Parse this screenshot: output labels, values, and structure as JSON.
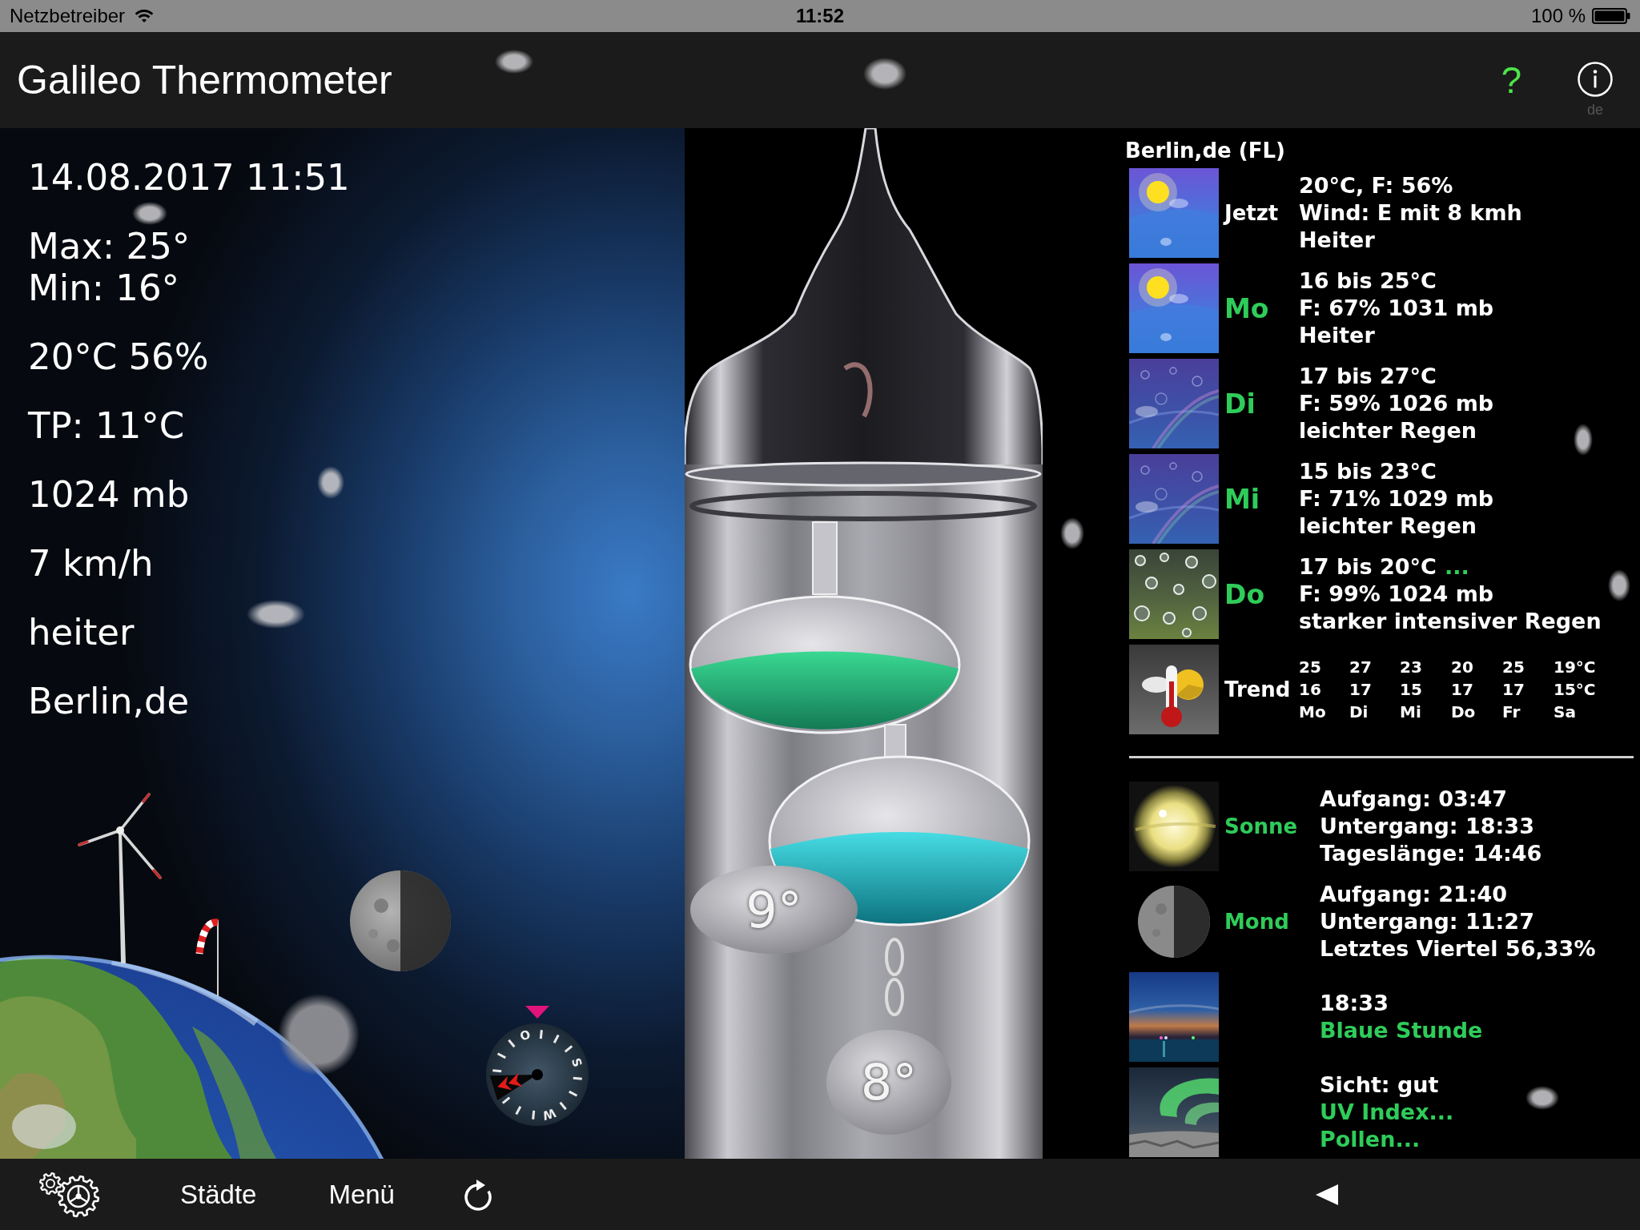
{
  "status_bar": {
    "carrier": "Netzbetreiber",
    "time": "11:52",
    "battery": "100 %"
  },
  "title_bar": {
    "title": "Galileo Thermometer",
    "help": "?",
    "language": "de"
  },
  "readings": [
    [
      "14.08.2017 11:51"
    ],
    [
      "Max: 25°",
      "Min: 16°"
    ],
    [
      "20°C 56%"
    ],
    [
      "TP: 11°C"
    ],
    [
      "1024 mb"
    ],
    [
      "7 km/h"
    ],
    [
      "heiter"
    ],
    [
      "Berlin,de"
    ]
  ],
  "compass": {
    "labels": [
      "O",
      "S",
      "W"
    ]
  },
  "thermometer": {
    "tags": [
      "9°",
      "8°"
    ]
  },
  "forecast": {
    "location": "Berlin,de (FL)",
    "rows": [
      {
        "kind": "now",
        "label": "Jetzt",
        "picture": {
          "kind": "sunny"
        },
        "lines": [
          "20°C, F: 56%",
          "Wind: E mit 8 kmh",
          "Heiter"
        ]
      },
      {
        "kind": "day",
        "label": "Mo",
        "picture": {
          "kind": "sunny"
        },
        "lines": [
          "16 bis 25°C",
          "F: 67% 1031 mb",
          "Heiter"
        ]
      },
      {
        "kind": "day",
        "label": "Di",
        "picture": {
          "kind": "rain"
        },
        "lines": [
          "17 bis 27°C",
          "F: 59% 1026 mb",
          "leichter Regen"
        ]
      },
      {
        "kind": "day",
        "label": "Mi",
        "picture": {
          "kind": "rain"
        },
        "lines": [
          "15 bis 23°C",
          "F: 71% 1029 mb",
          "leichter Regen"
        ]
      },
      {
        "kind": "day",
        "label": "Do",
        "picture": {
          "kind": "downpour"
        },
        "lines": [
          "17 bis 20°C",
          "F: 99% 1024 mb",
          "starker intensiver Regen"
        ],
        "more": "..."
      },
      {
        "kind": "trend",
        "label": "Trend",
        "picture": {
          "kind": "trend"
        },
        "highs": [
          "25",
          "27",
          "23",
          "20",
          "25",
          "19°C"
        ],
        "lows": [
          "16",
          "17",
          "15",
          "17",
          "17",
          "15°C"
        ],
        "days": [
          "Mo",
          "Di",
          "Mi",
          "Do",
          "Fr",
          "Sa"
        ]
      }
    ]
  },
  "astro": {
    "rows": [
      {
        "kind": "sun",
        "label": "Sonne",
        "lines": [
          {
            "text": "Aufgang: 03:47",
            "link": false
          },
          {
            "text": "Untergang: 18:33",
            "link": false
          },
          {
            "text": "Tageslänge: 14:46",
            "link": false
          }
        ]
      },
      {
        "kind": "moon",
        "label": "Mond",
        "lines": [
          {
            "text": "Aufgang: 21:40",
            "link": false
          },
          {
            "text": "Untergang: 11:27",
            "link": false
          },
          {
            "text": "Letztes Viertel 56,33%",
            "link": false
          }
        ]
      },
      {
        "kind": "dusk",
        "lines": [
          {
            "text": "18:33",
            "link": false
          },
          {
            "text": "Blaue Stunde",
            "link": true
          }
        ]
      },
      {
        "kind": "aurora",
        "lines": [
          {
            "text": "Sicht: gut",
            "link": false
          },
          {
            "text": "UV Index...",
            "link": true
          },
          {
            "text": "Pollen...",
            "link": true
          }
        ]
      }
    ]
  },
  "toolbar": {
    "cities": "Städte",
    "menu": "Menü"
  }
}
